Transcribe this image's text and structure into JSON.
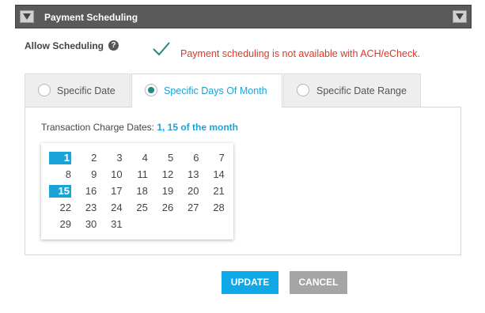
{
  "header": {
    "title": "Payment Scheduling",
    "left_icon": "triangle-down-icon",
    "right_icon": "triangle-down-icon"
  },
  "allow": {
    "label": "Allow Scheduling",
    "help_icon": "help-icon",
    "status_icon": "check-icon",
    "warning": "Payment scheduling is not available with ACH/eCheck."
  },
  "tabs": [
    {
      "label": "Specific Date",
      "selected": false
    },
    {
      "label": "Specific Days Of Month",
      "selected": true
    },
    {
      "label": "Specific Date Range",
      "selected": false
    }
  ],
  "charge": {
    "label": "Transaction Charge Dates:",
    "value": "1, 15 of the month"
  },
  "calendar": {
    "days": [
      "1",
      "2",
      "3",
      "4",
      "5",
      "6",
      "7",
      "8",
      "9",
      "10",
      "11",
      "12",
      "13",
      "14",
      "15",
      "16",
      "17",
      "18",
      "19",
      "20",
      "21",
      "22",
      "23",
      "24",
      "25",
      "26",
      "27",
      "28",
      "29",
      "30",
      "31"
    ],
    "selected": [
      "1",
      "15"
    ]
  },
  "buttons": {
    "update": "UPDATE",
    "cancel": "CANCEL"
  },
  "colors": {
    "accent": "#19a3d9",
    "warning": "#d9382c",
    "header_bg": "#5a5a5a",
    "check": "#1e8c80"
  }
}
